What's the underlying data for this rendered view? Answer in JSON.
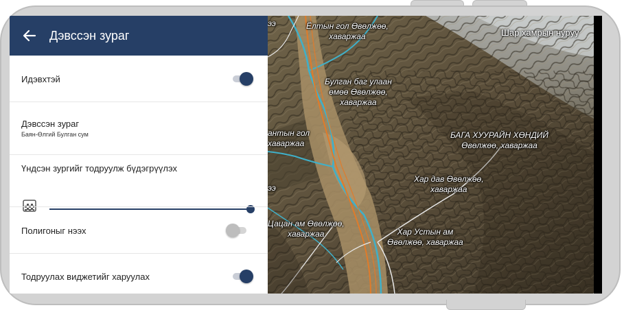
{
  "app_bar": {
    "title": "Дэвссэн зураг",
    "back_icon": "arrow-left-icon"
  },
  "settings": {
    "enabled": {
      "label": "Идэвхтэй",
      "on": true
    },
    "layer": {
      "label": "Дэвссэн зураг",
      "value": "Баян-Өлгий Булган сум"
    },
    "transparency": {
      "label": "Үндсэн зургийг тодруулж бүдэгрүүлэх",
      "icon": "checkerboard-icon",
      "level": 1.0
    },
    "polygons": {
      "label": "Полигоныг нээх",
      "on": false
    },
    "widget": {
      "label": "Тодруулах виджетийг харуулах",
      "on": true
    }
  },
  "map": {
    "ridge_label": "Шар хамрын нуруу",
    "labels": [
      {
        "lines": [
          "Ёлтын гол Өвөлжөө,",
          "хаваржаа"
        ]
      },
      {
        "lines": [
          "Булган баг улаан",
          "өмөө Өвөлжөө,",
          "хаваржаа"
        ]
      },
      {
        "lines": [
          "БАГА ХУУРАЙН ХӨНДИЙ",
          "Өвөлжөө, хаваржаа"
        ]
      },
      {
        "lines": [
          "антын гол",
          "хаваржаа"
        ]
      },
      {
        "lines": [
          "Хар дав Өвөлжөө,",
          "хаваржаа"
        ]
      },
      {
        "lines": [
          "Хар Устын ам",
          "Өвөлжөө, хаваржаа"
        ]
      },
      {
        "lines": [
          "Цацан ам Өвөлжөө,",
          "хаваржаа"
        ]
      },
      {
        "lines": [
          "ээ"
        ]
      },
      {
        "lines": [
          "ээ"
        ]
      }
    ]
  },
  "colors": {
    "primary": "#263f66",
    "river": "#3fb0c9",
    "road": "#e07b2a"
  }
}
